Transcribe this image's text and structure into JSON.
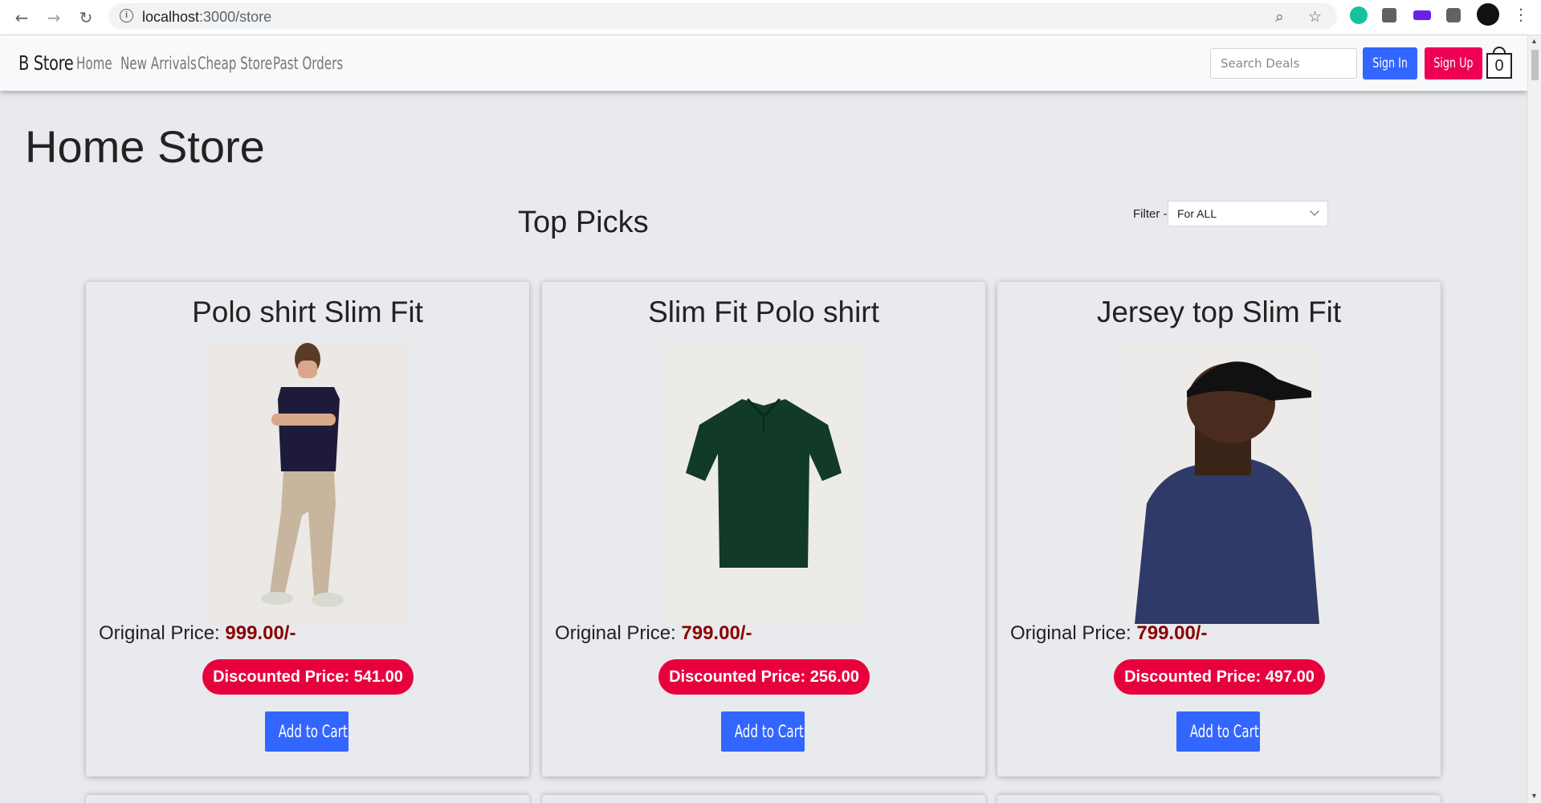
{
  "browser": {
    "url_host": "localhost",
    "url_path": ":3000/store"
  },
  "navbar": {
    "brand": "B Store",
    "links": [
      "Home",
      "New Arrivals",
      "Cheap Store",
      "Past Orders"
    ],
    "search_placeholder": "Search Deals",
    "sign_in_label": "Sign In",
    "sign_up_label": "Sign Up",
    "cart_count": "0"
  },
  "page": {
    "title": "Home Store",
    "section_title": "Top Picks",
    "filter_label": "Filter -",
    "filter_selected": "For ALL"
  },
  "products": [
    {
      "name": "Polo shirt Slim Fit",
      "original_label": "Original Price: ",
      "original_price": "999.00/-",
      "discounted": "Discounted Price: 541.00",
      "add_label": "Add to Cart"
    },
    {
      "name": "Slim Fit Polo shirt",
      "original_label": "Original Price: ",
      "original_price": "799.00/-",
      "discounted": "Discounted Price: 256.00",
      "add_label": "Add to Cart"
    },
    {
      "name": "Jersey top Slim Fit",
      "original_label": "Original Price: ",
      "original_price": "799.00/-",
      "discounted": "Discounted Price: 497.00",
      "add_label": "Add to Cart"
    }
  ],
  "colors": {
    "primary_button": "#3366ff",
    "signup_button": "#ee0055",
    "discount_pill": "#e8003d",
    "price_text": "#8b0000",
    "page_bg": "#e8eaed"
  }
}
